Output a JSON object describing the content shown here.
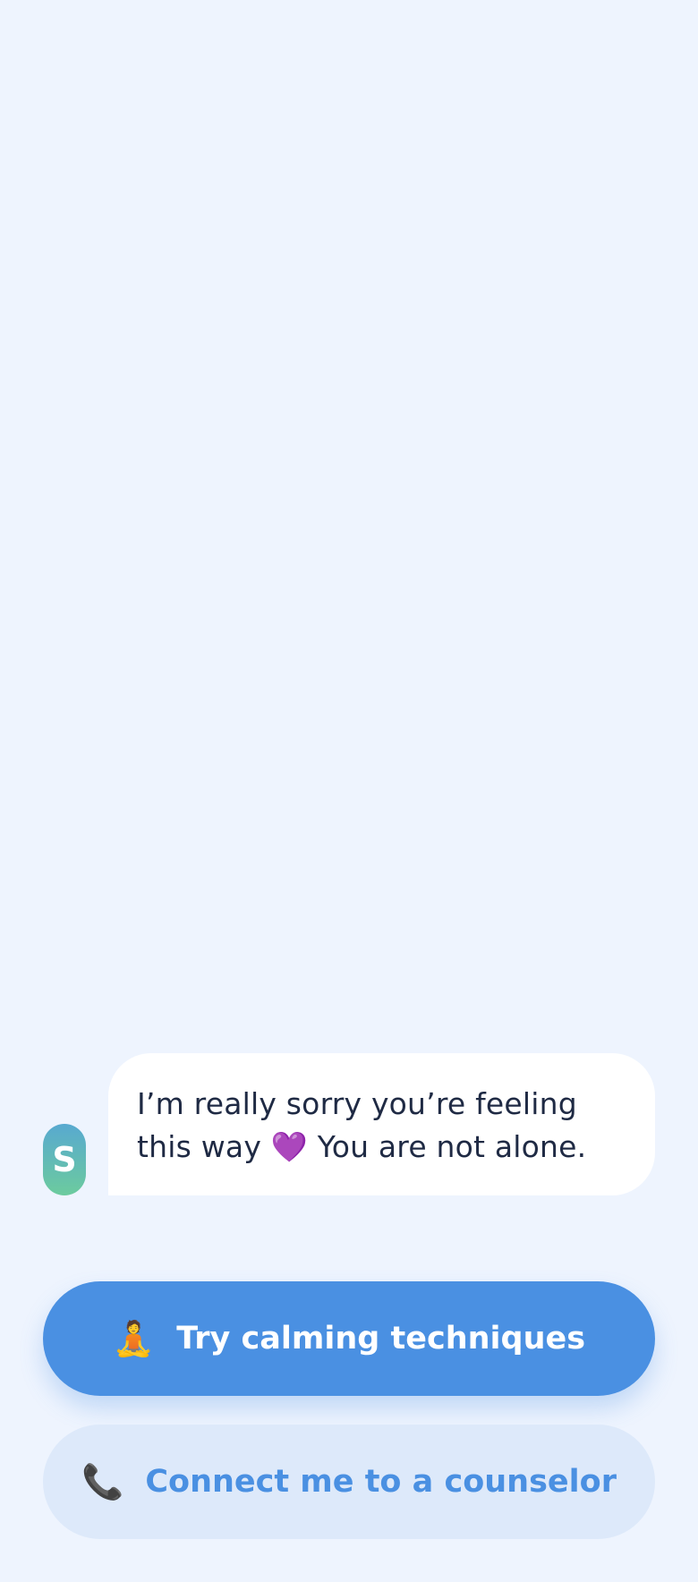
{
  "chat": {
    "assistant_avatar_letter": "S",
    "messages": [
      {
        "sender": "assistant",
        "text": "I’m really sorry you’re feeling this way 💜 You are not alone."
      }
    ]
  },
  "actions": {
    "calming": {
      "icon": "meditation-icon",
      "emoji": "🧘",
      "label": "Try calming techniques"
    },
    "counselor": {
      "icon": "phone-icon",
      "emoji": "📞",
      "label": "Connect me to a counselor"
    }
  },
  "colors": {
    "background": "#eef4fe",
    "primary": "#4a90e2",
    "secondary_bg": "#dde9fa",
    "bubble": "#ffffff",
    "text": "#1f2a44"
  }
}
